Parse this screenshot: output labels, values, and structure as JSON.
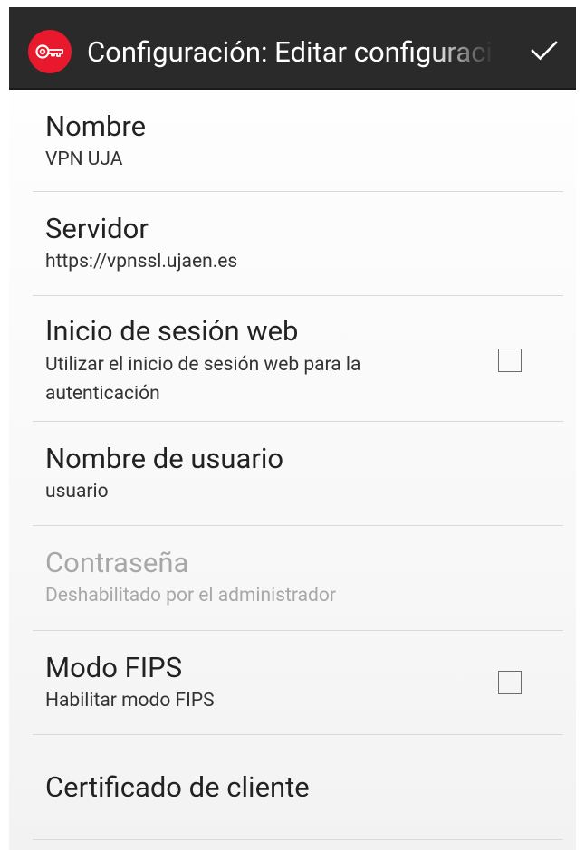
{
  "action_bar": {
    "title": "Configuración: Editar configuración",
    "app_icon": "key-icon",
    "confirm_icon": "checkmark-icon"
  },
  "colors": {
    "action_bar_bg": "#2a2a2a",
    "app_icon_bg": "#e8192c",
    "disabled_text": "#a8a8a8"
  },
  "settings": {
    "name": {
      "label": "Nombre",
      "summary": "VPN UJA"
    },
    "server": {
      "label": "Servidor",
      "summary": "https://vpnssl.ujaen.es"
    },
    "web_login": {
      "label": "Inicio de sesión web",
      "summary": "Utilizar el inicio de sesión web para la autenticación",
      "checked": false
    },
    "username": {
      "label": "Nombre de usuario",
      "summary": "usuario"
    },
    "password": {
      "label": "Contraseña",
      "summary": "Deshabilitado por el administrador",
      "enabled": false
    },
    "fips": {
      "label": "Modo FIPS",
      "summary": "Habilitar modo FIPS",
      "checked": false
    },
    "client_cert": {
      "label": "Certificado de cliente"
    }
  }
}
